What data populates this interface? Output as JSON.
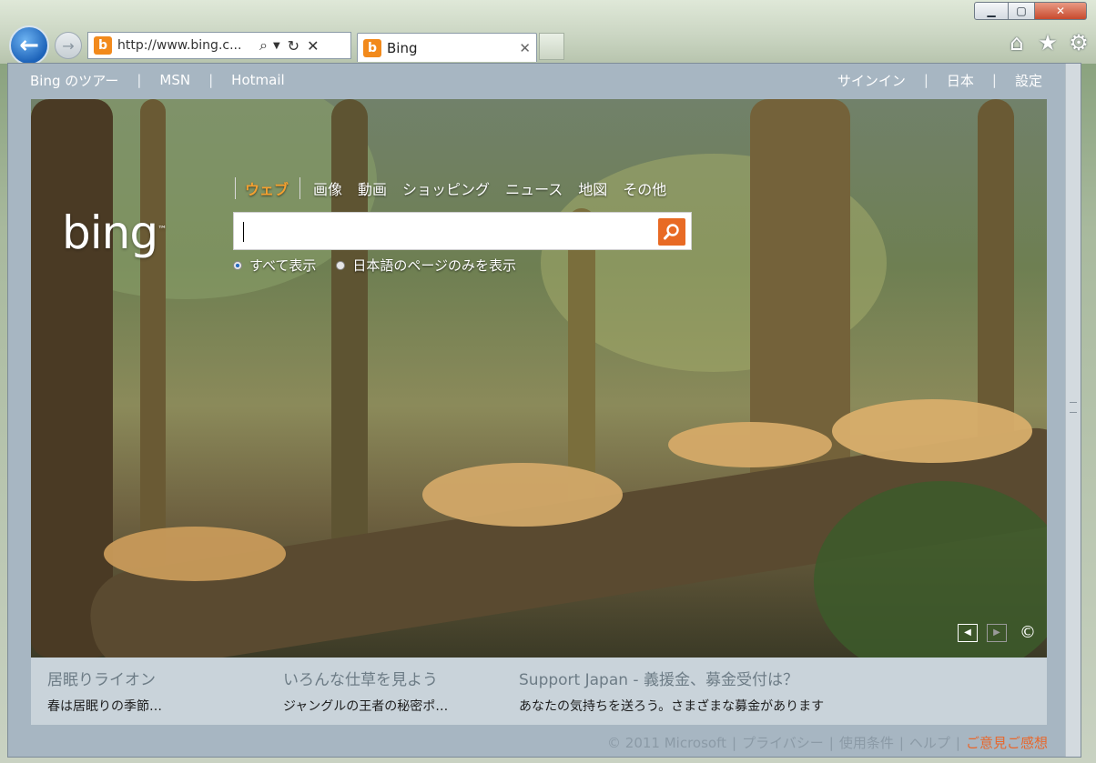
{
  "browser": {
    "address_url": "http://www.bing.c...",
    "tab_title": "Bing",
    "tab_favicon": "b",
    "window_controls": [
      "minimize-icon",
      "maximize-icon",
      "close-icon"
    ],
    "toolbar_icons": [
      "home-icon",
      "star-icon",
      "gear-icon"
    ]
  },
  "topnav": {
    "left": [
      "Bing のツアー",
      "MSN",
      "Hotmail"
    ],
    "right": [
      "サインイン",
      "日本",
      "設定"
    ],
    "separator": "|"
  },
  "search": {
    "logo": "bing",
    "tabs": [
      "ウェブ",
      "画像",
      "動画",
      "ショッピング",
      "ニュース",
      "地図",
      "その他"
    ],
    "active_tab": "ウェブ",
    "input_value": "",
    "options": [
      "すべて表示",
      "日本語のページのみを表示"
    ],
    "selected_option": "すべて表示"
  },
  "hero_controls": {
    "prev": "◀",
    "next": "▶",
    "copyright": "©"
  },
  "news": [
    {
      "title": "居眠りライオン",
      "desc": "春は居眠りの季節…"
    },
    {
      "title": "いろんな仕草を見よう",
      "desc": "ジャングルの王者の秘密ポ…"
    },
    {
      "title": "Support Japan - 義援金、募金受付は？",
      "desc": "あなたの気持ちを送ろう。さまざまな募金があります"
    }
  ],
  "footer": {
    "items": [
      "© 2011 Microsoft",
      "プライバシー",
      "使用条件",
      "ヘルプ"
    ],
    "feedback": "ご意見ご感想",
    "separator": "|"
  },
  "colors": {
    "accent_orange": "#f4a030",
    "search_button": "#e86a24",
    "feedback_link": "#e8672c"
  }
}
